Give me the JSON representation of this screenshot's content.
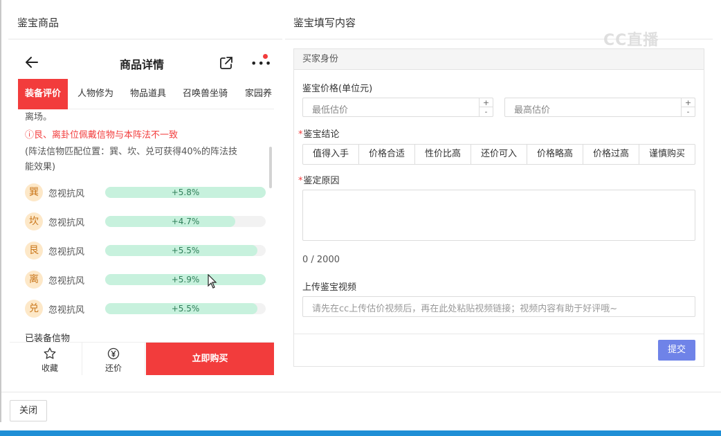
{
  "left_panel": {
    "title": "鉴宝商品"
  },
  "right_panel": {
    "title": "鉴宝填写内容"
  },
  "watermark": "CC直播",
  "phone": {
    "title": "商品详情",
    "tabs": [
      "装备评价",
      "人物修为",
      "物品道具",
      "召唤兽坐骑",
      "家园养"
    ],
    "text_top": "离场。",
    "warning": "ⓘ艮、离卦位佩戴信物与本阵法不一致",
    "note_line1": "(阵法信物匹配位置：巽、坎、兑可获得40%的阵法技",
    "note_line2": "能效果)",
    "attributes": [
      {
        "badge": "巽",
        "name": "忽视抗风",
        "value": "+5.8%",
        "level": 1.0
      },
      {
        "badge": "坎",
        "name": "忽视抗风",
        "value": "+4.7%",
        "level": 0.81
      },
      {
        "badge": "艮",
        "name": "忽视抗风",
        "value": "+5.5%",
        "level": 0.95
      },
      {
        "badge": "离",
        "name": "忽视抗风",
        "value": "+5.9%",
        "level": 1.0
      },
      {
        "badge": "兑",
        "name": "忽视抗风",
        "value": "+5.5%",
        "level": 0.95
      }
    ],
    "equipped_label": "已装备信物",
    "bottom": {
      "favorite": "收藏",
      "bargain": "还价",
      "buy": "立即购买"
    }
  },
  "form": {
    "section": "买家身份",
    "price_label": "鉴宝价格(单位元)",
    "min_placeholder": "最低估价",
    "max_placeholder": "最高估价",
    "spin_up": "+",
    "spin_down": "-",
    "conclusion_label": "鉴宝结论",
    "conclusions": [
      "值得入手",
      "价格合适",
      "性价比高",
      "还价可入",
      "价格略高",
      "价格过高",
      "谨慎购买"
    ],
    "reason_label": "鉴定原因",
    "counter": "0 / 2000",
    "video_label": "上传鉴宝视频",
    "video_placeholder": "请先在cc上传估价视频后，再在此处粘贴视频链接；视频内容有助于好评哦~",
    "submit": "提交"
  },
  "footer": {
    "close": "关闭"
  }
}
